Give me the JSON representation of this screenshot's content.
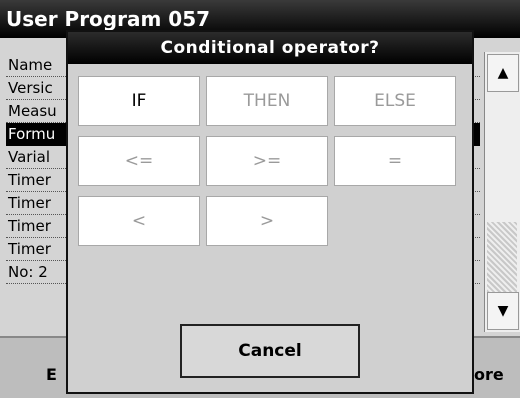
{
  "background": {
    "title": "User Program 057",
    "rows": [
      "Name",
      "Versic",
      "Measu",
      "Formu",
      "Varial",
      "Timer",
      "Timer",
      "Timer",
      "Timer",
      "No: 2"
    ],
    "selected_index": 3,
    "bottom_left_label": "E",
    "bottom_right_label": "ore"
  },
  "scrollbar": {
    "up_icon": "▲",
    "down_icon": "▼"
  },
  "dialog": {
    "title": "Conditional operator?",
    "buttons": {
      "if": "IF",
      "then": "THEN",
      "else": "ELSE",
      "le": "<=",
      "ge": ">=",
      "eq": "=",
      "lt": "<",
      "gt": ">"
    },
    "cancel": "Cancel"
  }
}
